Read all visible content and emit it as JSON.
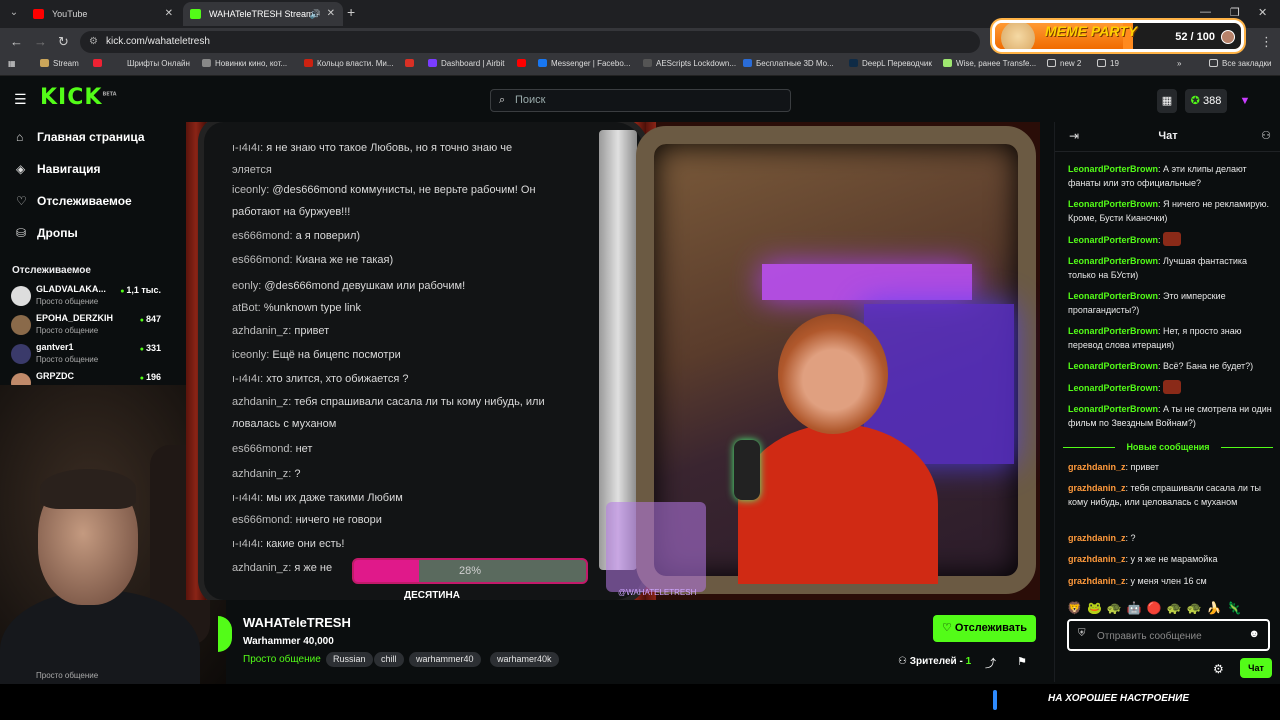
{
  "browser": {
    "tabs": [
      {
        "title": "YouTube",
        "favicon_color": "#ff0000"
      },
      {
        "title": "WAHATeleTRESH Stream - ",
        "favicon_color": "#53fc18"
      }
    ],
    "url": "kick.com/wahateletresh",
    "bookmarks": [
      "Stream",
      "Шрифты Онлайн",
      "Новинки кино, кот...",
      "Кольцо власти. Ми...",
      "Dashboard | Airbit",
      "Messenger | Facebo...",
      "AEScripts Lockdown...",
      "Бесплатные 3D Mo...",
      "DeepL Переводчик",
      "Wise, ранее Transfe...",
      "new 2",
      "19",
      "Все закладки"
    ]
  },
  "overlay": {
    "meme_title": "MEME PARTY",
    "meme_count": "52 / 100",
    "meme_progress": 0.52
  },
  "header": {
    "logo": "KICK",
    "beta": "BETA",
    "search_placeholder": "Поиск",
    "points": "388"
  },
  "sidebar": {
    "nav": [
      {
        "label": "Главная страница",
        "icon": "home-icon"
      },
      {
        "label": "Навигация",
        "icon": "compass-icon"
      },
      {
        "label": "Отслеживаемое",
        "icon": "heart-icon"
      },
      {
        "label": "Дропы",
        "icon": "gift-icon"
      }
    ],
    "following_title": "Отслеживаемое",
    "following": [
      {
        "name": "GLADVALAKA...",
        "category": "Просто общение",
        "viewers": "1,1 тыс."
      },
      {
        "name": "EPOHA_DERZKIH",
        "category": "Просто общение",
        "viewers": "847"
      },
      {
        "name": "gantver1",
        "category": "Просто общение",
        "viewers": "331"
      },
      {
        "name": "GRPZDC",
        "category": "",
        "viewers": "196"
      }
    ],
    "cam_caption": "Просто общение"
  },
  "video": {
    "chat_lines": [
      {
        "user": "",
        "text": "я не знаю что такое Любовь, но я точно знаю че",
        "prefix": "ı-ı4ı4ı:"
      },
      {
        "user": "",
        "text": "",
        "prefix": "эляется"
      },
      {
        "user": "iceonly:",
        "text": "@des666mond  коммунисты, не верьте рабочим! Он",
        "prefix": ""
      },
      {
        "user": "",
        "text": "работают на буржуев!!!",
        "prefix": ""
      },
      {
        "user": "es666mond:",
        "text": "а я поверил)",
        "prefix": ""
      },
      {
        "user": "es666mond:",
        "text": "Киана же не такая)",
        "prefix": ""
      },
      {
        "user": "eonly:",
        "text": "@des666mond  девушкам или рабочим!",
        "prefix": ""
      },
      {
        "user": "atBot:",
        "text": "%unknown type link",
        "prefix": ""
      },
      {
        "user": "azhdanin_z:",
        "text": "привет",
        "prefix": ""
      },
      {
        "user": "iceonly:",
        "text": "Ещё на бицепс посмотри",
        "prefix": ""
      },
      {
        "user": "ı-ı4ı4ı:",
        "text": "хто злится, хто обижается ?",
        "prefix": ""
      },
      {
        "user": "azhdanin_z:",
        "text": "тебя спрашивали сасала ли  ты кому нибудь, или",
        "prefix": ""
      },
      {
        "user": "",
        "text": "ловалась с муханом",
        "prefix": ""
      },
      {
        "user": "es666mond:",
        "text": "нет",
        "prefix": ""
      },
      {
        "user": "azhdanin_z:",
        "text": "?",
        "prefix": ""
      },
      {
        "user": "ı-ı4ı4ı:",
        "text": "мы их даже такими Любим",
        "prefix": ""
      },
      {
        "user": "es666mond:",
        "text": "ничего не говори",
        "prefix": ""
      },
      {
        "user": "ı-ı4ı4ı:",
        "text": "какие они есть!",
        "prefix": ""
      },
      {
        "user": "azhdanin_z:",
        "text": "я же не",
        "prefix": ""
      }
    ],
    "goal_percent_label": "28%",
    "goal_progress": 0.28,
    "qr_label": "@WAHATELETRESH",
    "bottom_text": "ДЕСЯТИНА"
  },
  "stream": {
    "title": "WAHATeleTRESH",
    "game": "Warhammer 40,000",
    "category": "Просто общение",
    "tags": [
      "Russian",
      "chill",
      "warhammer40",
      "warhamer40k"
    ],
    "follow_label": "Отслеживать",
    "viewers_label": "Зрителей -",
    "viewers_count": "1"
  },
  "chat": {
    "title": "Чат",
    "messages": [
      {
        "user": "LeonardPorterBrown",
        "text": "А эти клипы делают фанаты или это официальные?",
        "emote": false
      },
      {
        "user": "LeonardPorterBrown",
        "text": "Я ничего не рекламирую. Кроме, Бусти Кианочки)",
        "emote": false
      },
      {
        "user": "LeonardPorterBrown",
        "text": "",
        "emote": true
      },
      {
        "user": "LeonardPorterBrown",
        "text": "Лучшая фантастика только на БУсти)",
        "emote": false
      },
      {
        "user": "LeonardPorterBrown",
        "text": "Это имперские пропагандисты?)",
        "emote": false
      },
      {
        "user": "LeonardPorterBrown",
        "text": "Нет, я просто знаю перевод слова итерация)",
        "emote": false
      },
      {
        "user": "LeonardPorterBrown",
        "text": "Всё? Бана не будет?)",
        "emote": false
      },
      {
        "user": "LeonardPorterBrown",
        "text": "",
        "emote": true
      },
      {
        "user": "LeonardPorterBrown",
        "text": "А ты не смотрела ни один фильм по Звездным Войнам?)",
        "emote": false
      }
    ],
    "new_separator": "Новые сообщения",
    "new_messages": [
      {
        "user": "grazhdanin_z",
        "text": "привет"
      },
      {
        "user": "grazhdanin_z",
        "text": "тебя спрашивали сасала ли ты кому нибудь, или целовалась с муханом"
      },
      {
        "user": "grazhdanin_z",
        "text": "?"
      },
      {
        "user": "grazhdanin_z",
        "text": "у я же не марамойка"
      },
      {
        "user": "grazhdanin_z",
        "text": "у меня член 16 см"
      }
    ],
    "input_placeholder": "Отправить сообщение",
    "send_label": "Чат"
  },
  "bottom": {
    "mood_text": "НА ХОРОШЕЕ НАСТРОЕНИЕ"
  }
}
